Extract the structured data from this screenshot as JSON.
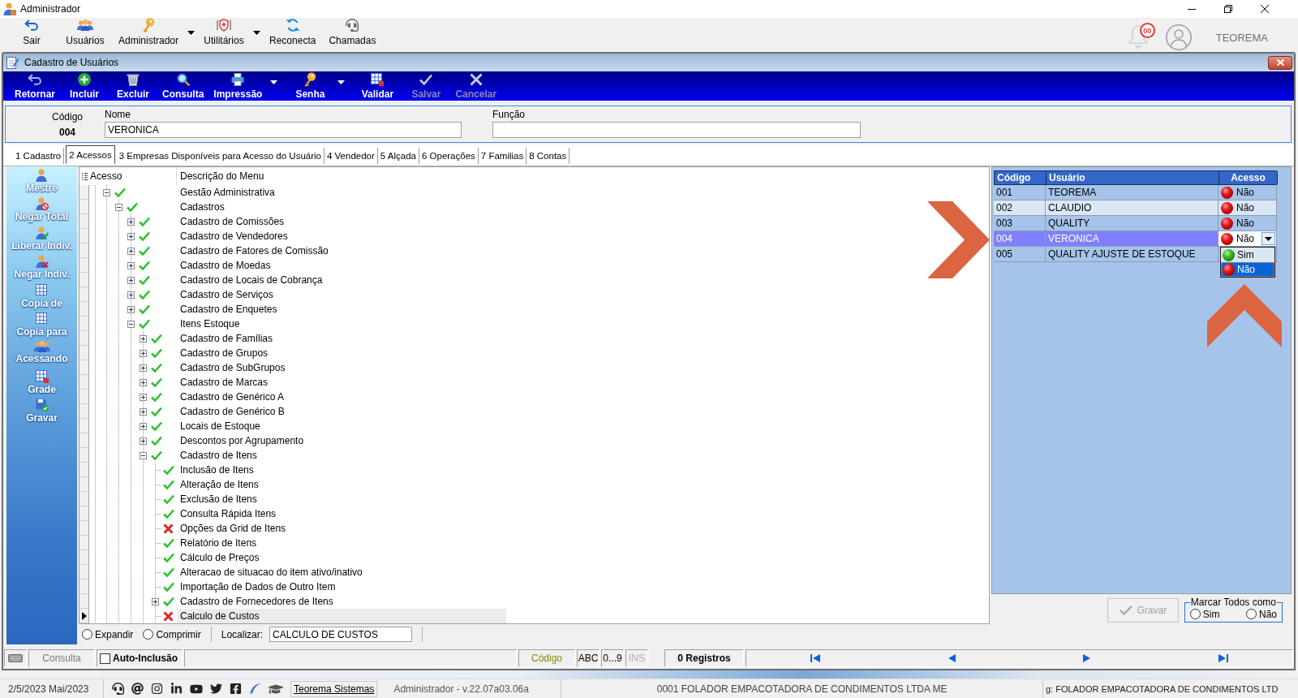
{
  "window": {
    "title": "Administrador"
  },
  "main_toolbar": {
    "buttons": [
      {
        "label": "Sair",
        "menu": false
      },
      {
        "label": "Usuários",
        "menu": false
      },
      {
        "label": "Administrador",
        "menu": true
      },
      {
        "label": "Utilitários",
        "menu": true
      },
      {
        "label": "Reconecta",
        "menu": false
      },
      {
        "label": "Chamadas",
        "menu": false
      }
    ],
    "notifications": {
      "badge": "00"
    },
    "user": {
      "name": "TEOREMA"
    }
  },
  "form": {
    "title": "Cadastro de Usuários",
    "toolbar": [
      {
        "label": "Retornar",
        "menu": false,
        "disabled": false
      },
      {
        "label": "Incluir",
        "menu": false,
        "disabled": false
      },
      {
        "label": "Excluir",
        "menu": false,
        "disabled": false
      },
      {
        "label": "Consulta",
        "menu": false,
        "disabled": false
      },
      {
        "label": "Impressão",
        "menu": true,
        "disabled": false
      },
      {
        "label": "Senha",
        "menu": true,
        "disabled": false
      },
      {
        "label": "Validar",
        "menu": false,
        "disabled": false
      },
      {
        "label": "Salvar",
        "menu": false,
        "disabled": true
      },
      {
        "label": "Cancelar",
        "menu": false,
        "disabled": true
      }
    ],
    "fields": {
      "code": {
        "label": "Código",
        "value": "004"
      },
      "name": {
        "label": "Nome",
        "value": "VERONICA"
      },
      "role": {
        "label": "Função"
      }
    },
    "tabs": [
      {
        "label": "1 Cadastro",
        "selected": false
      },
      {
        "label": "2 Acessos",
        "selected": true
      },
      {
        "label": "3 Empresas Disponíveis para Acesso do Usuário",
        "selected": false
      },
      {
        "label": "4 Vendedor",
        "selected": false
      },
      {
        "label": "5 Alçada",
        "selected": false
      },
      {
        "label": "6 Operações",
        "selected": false
      },
      {
        "label": "7 Familias",
        "selected": false
      },
      {
        "label": "8 Contas",
        "selected": false
      }
    ]
  },
  "sidebar": {
    "items": [
      {
        "label": "Mestre"
      },
      {
        "label": "Negar Total"
      },
      {
        "label": "Liberar Indiv."
      },
      {
        "label": "Negar Indiv."
      },
      {
        "label": "Copia de"
      },
      {
        "label": "Copia para"
      },
      {
        "label": "Acessando"
      },
      {
        "label": "Grade"
      },
      {
        "label": "Gravar"
      }
    ]
  },
  "tree": {
    "columns": [
      "Acesso",
      "Descrição do Menu"
    ],
    "nodes": [
      {
        "label": "Gestão Administrativa",
        "access": true,
        "expanded": true,
        "selected": false,
        "children": [
          {
            "label": "Cadastros",
            "access": true,
            "expanded": true,
            "selected": false,
            "children": [
              {
                "label": "Cadastro de Comissões",
                "access": true,
                "expanded": false,
                "selected": false
              },
              {
                "label": "Cadastro de Vendedores",
                "access": true,
                "expanded": false,
                "selected": false
              },
              {
                "label": "Cadastro de Fatores de Comissão",
                "access": true,
                "expanded": false,
                "selected": false
              },
              {
                "label": "Cadastro de Moedas",
                "access": true,
                "expanded": false,
                "selected": false
              },
              {
                "label": "Cadastro de Locais de Cobrança",
                "access": true,
                "expanded": false,
                "selected": false
              },
              {
                "label": "Cadastro de Serviços",
                "access": true,
                "expanded": false,
                "selected": false
              },
              {
                "label": "Cadastro de Enquetes",
                "access": true,
                "expanded": false,
                "selected": false
              },
              {
                "label": "Itens Estoque",
                "access": true,
                "expanded": true,
                "selected": false,
                "children": [
                  {
                    "label": "Cadastro de Famílias",
                    "access": true,
                    "expanded": false,
                    "selected": false
                  },
                  {
                    "label": "Cadastro de Grupos",
                    "access": true,
                    "expanded": false,
                    "selected": false
                  },
                  {
                    "label": "Cadastro de SubGrupos",
                    "access": true,
                    "expanded": false,
                    "selected": false
                  },
                  {
                    "label": "Cadastro de Marcas",
                    "access": true,
                    "expanded": false,
                    "selected": false
                  },
                  {
                    "label": "Cadastro de Genérico A",
                    "access": true,
                    "expanded": false,
                    "selected": false
                  },
                  {
                    "label": "Cadastro de Genérico B",
                    "access": true,
                    "expanded": false,
                    "selected": false
                  },
                  {
                    "label": "Locais de Estoque",
                    "access": true,
                    "expanded": false,
                    "selected": false
                  },
                  {
                    "label": "Descontos por Agrupamento",
                    "access": true,
                    "expanded": false,
                    "selected": false
                  },
                  {
                    "label": "Cadastro de Itens",
                    "access": true,
                    "expanded": true,
                    "selected": false,
                    "children": [
                      {
                        "label": "Inclusão de Itens",
                        "access": true,
                        "selected": false
                      },
                      {
                        "label": "Alteração de Itens",
                        "access": true,
                        "selected": false
                      },
                      {
                        "label": "Exclusão de Itens",
                        "access": true,
                        "selected": false
                      },
                      {
                        "label": "Consulta Rápida Itens",
                        "access": true,
                        "selected": false
                      },
                      {
                        "label": "Opções da Grid de Itens",
                        "access": false,
                        "selected": false
                      },
                      {
                        "label": "Relatório de Itens",
                        "access": true,
                        "selected": false
                      },
                      {
                        "label": "Cálculo de Preços",
                        "access": true,
                        "selected": false
                      },
                      {
                        "label": "Alteracao de situacao do item ativo/inativo",
                        "access": true,
                        "selected": false
                      },
                      {
                        "label": "Importação de Dados de Outro Item",
                        "access": true,
                        "selected": false
                      },
                      {
                        "label": "Cadastro de Fornecedores de Itens",
                        "access": true,
                        "expanded": false,
                        "selected": false
                      },
                      {
                        "label": "Calculo de Custos",
                        "access": false,
                        "selected": true
                      }
                    ]
                  }
                ]
              }
            ]
          }
        ]
      }
    ]
  },
  "tree_footer": {
    "options": [
      {
        "label": "Expandir",
        "selected": false
      },
      {
        "label": "Comprimir",
        "selected": false
      }
    ],
    "search": {
      "label": "Localizar:",
      "value": "CALCULO DE CUSTOS"
    }
  },
  "users_grid": {
    "columns": [
      "Código",
      "Usuário",
      "Acesso"
    ],
    "rows": [
      {
        "code": "001",
        "user": "TEOREMA",
        "access": "Não",
        "granted": false,
        "selected": false
      },
      {
        "code": "002",
        "user": "CLAUDIO",
        "access": "Não",
        "granted": false,
        "selected": false
      },
      {
        "code": "003",
        "user": "QUALITY",
        "access": "Não",
        "granted": false,
        "selected": false
      },
      {
        "code": "004",
        "user": "VERONICA",
        "access": "Não",
        "granted": false,
        "selected": true
      },
      {
        "code": "005",
        "user": "QUALITY AJUSTE DE ESTOQUE",
        "selected": false
      }
    ],
    "dropdown": {
      "options": [
        {
          "label": "Sim",
          "granted": true,
          "selected": false
        },
        {
          "label": "Não",
          "granted": false,
          "selected": true
        }
      ]
    }
  },
  "save_button": {
    "label": "Gravar",
    "disabled": true
  },
  "mark_all": {
    "title": "Marcar Todos como",
    "options": [
      {
        "label": "Sim",
        "selected": false
      },
      {
        "label": "Não",
        "selected": false
      }
    ]
  },
  "status_bar": {
    "mode": "Consulta",
    "auto_include": {
      "label": "Auto-Inclusão",
      "checked": false
    },
    "order": "Código",
    "indicators": [
      {
        "label": "ABC",
        "disabled": false
      },
      {
        "label": "0...9",
        "disabled": false
      },
      {
        "label": "INS",
        "disabled": true
      }
    ],
    "records": "0 Registros"
  },
  "taskbar": {
    "date": "2/5/2023 Mai/2023",
    "link": "Teorema Sistemas",
    "version": "Administrador - v.22.07a03.06a",
    "company": "0001 FOLADOR EMPACOTADORA DE CONDIMENTOS LTDA ME",
    "company_repeat": "g: FOLADOR EMPACOTADORA DE CONDIMENTOS LTD"
  }
}
